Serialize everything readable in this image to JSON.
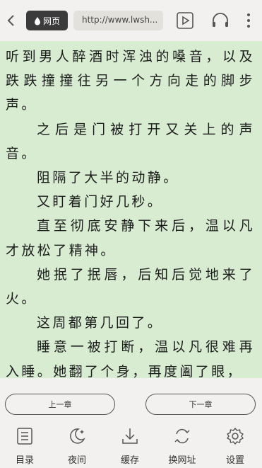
{
  "toolbar": {
    "back_label": "‹",
    "web_label": "网页",
    "url": "http://www.lwsh..."
  },
  "content": {
    "paragraphs": [
      {
        "text": "听到男人醉酒时浑浊的嗓音，以及跌跌撞撞往另一个方向走的脚步声。",
        "indent": false
      },
      {
        "text": "之后是门被打开又关上的声音。",
        "indent": true
      },
      {
        "text": "阻隔了大半的动静。",
        "indent": true
      },
      {
        "text": "又盯着门好几秒。",
        "indent": true
      },
      {
        "text": "直至彻底安静下来后，温以凡才放松了精神。",
        "indent": true
      },
      {
        "text": "她抿了抿唇，后知后觉地来了火。",
        "indent": true
      },
      {
        "text": "这周都第几回了。",
        "indent": true
      },
      {
        "text": "睡意一被打断，温以凡很难再入睡。她翻了个身，再度阖了眼，",
        "indent": true
      }
    ]
  },
  "nav": {
    "prev_label": "上一章",
    "next_label": "下一章"
  },
  "bottom": {
    "items": [
      {
        "label": "目录",
        "icon": "list-icon"
      },
      {
        "label": "夜间",
        "icon": "moon-icon"
      },
      {
        "label": "缓存",
        "icon": "download-icon"
      },
      {
        "label": "换网址",
        "icon": "switch-icon"
      },
      {
        "label": "设置",
        "icon": "gear-icon"
      }
    ]
  },
  "colors": {
    "reading_bg": "#d7ecd1",
    "bar_bg": "#f2f1ef",
    "pill_bg": "#3b3b3b"
  }
}
